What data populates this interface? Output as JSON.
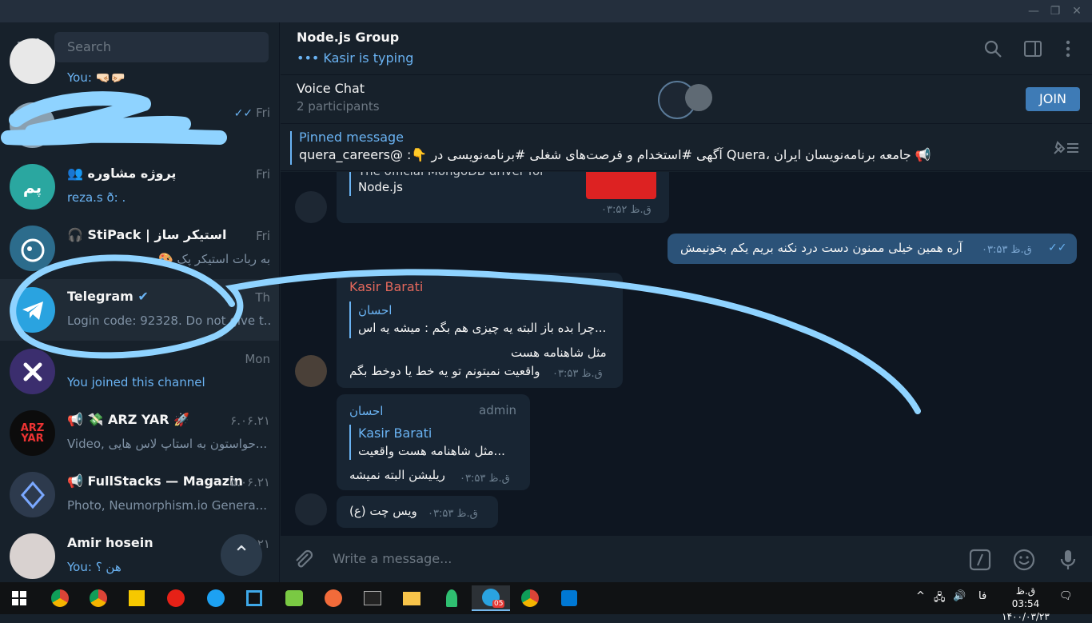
{
  "sidebar": {
    "search_placeholder": "Search",
    "chats": [
      {
        "name": "",
        "time": "",
        "preview": "You: 🤜🏻🤛🏻"
      },
      {
        "name": "",
        "time": "Fri",
        "preview": ""
      },
      {
        "name": "پروژه مشاوره",
        "time": "Fri",
        "preview": "reza.s ð: .",
        "avatar_text": "پم",
        "avatar_color": "#2aa7a0"
      },
      {
        "name": "StiPack | استیکر ساز",
        "time": "Fri",
        "preview": "به ربات  استیکر پک 🎨 ..."
      },
      {
        "name": "Telegram",
        "time": "Th",
        "preview": "Login code: 92328. Do not give t..."
      },
      {
        "name": "",
        "time": "Mon",
        "preview": "You joined this channel"
      },
      {
        "name": "💸 ARZ YAR 🚀",
        "time": "۶.۰۶.۲۱",
        "preview": "Video, حواستون به استاپ لاس هایی..."
      },
      {
        "name": "FullStacks — Magazine",
        "time": "۵.۰۶.۲۱",
        "preview": "Photo, Neumorphism.io Genera..."
      },
      {
        "name": "Amir hosein",
        "time": "۲۱",
        "preview": "You: هن ؟"
      }
    ]
  },
  "header": {
    "title": "Node.js Group",
    "status": "••• Kasir is typing"
  },
  "voice_chat": {
    "title": "Voice Chat",
    "participants": "2 participants",
    "join_label": "JOIN"
  },
  "pinned": {
    "label": "Pinned message",
    "text": "📢 جامعه برنامه‌نویسان ایران ،Quera آگهی #استخدام و فرصت‌های شغلی #برنامه‌نویسی در 👇: @quera_careers"
  },
  "messages": {
    "m1": {
      "text1": "The official MongoDB driver for",
      "text2": "Node.js",
      "time": "ق.ظ ۰۳:۵۲"
    },
    "m2": {
      "text": "آره همین خیلی ممنون دست درد نکنه بریم یکم بخونیمش",
      "time": "ق.ظ ۰۳:۵۳"
    },
    "m3": {
      "sender": "Kasir Barati",
      "reply_name": "احسان",
      "reply_text": "چرا بده باز  البته یه چیزی هم بگم :  میشه یه اس...",
      "line1": "مثل شاهنامه هست",
      "line2": "واقعیت نمیتونم تو یه خط یا دوخط بگم",
      "time": "ق.ظ ۰۳:۵۳"
    },
    "m4": {
      "sender": "احسان",
      "role": "admin",
      "reply_name": "Kasir Barati",
      "reply_text": "مثل شاهنامه هست واقعیت...",
      "text": "ریلیشن البته نمیشه",
      "time": "ق.ظ ۰۳:۵۳"
    },
    "m5": {
      "text": "ویس چت (ع)",
      "time": "ق.ظ ۰۳:۵۳"
    }
  },
  "composer": {
    "placeholder": "Write a message..."
  },
  "taskbar": {
    "lang": "فا",
    "time": "ق.ظ 03:54",
    "date": "۱۴۰۰/۰۳/۲۳",
    "telegram_badge": "05"
  },
  "colors": {
    "accent": "#6ab3f3",
    "bg": "#0e1621",
    "panel": "#17212b",
    "outgoing": "#2b5278",
    "incoming": "#182533",
    "sender_red": "#e3685c",
    "join": "#3e7bb6"
  }
}
